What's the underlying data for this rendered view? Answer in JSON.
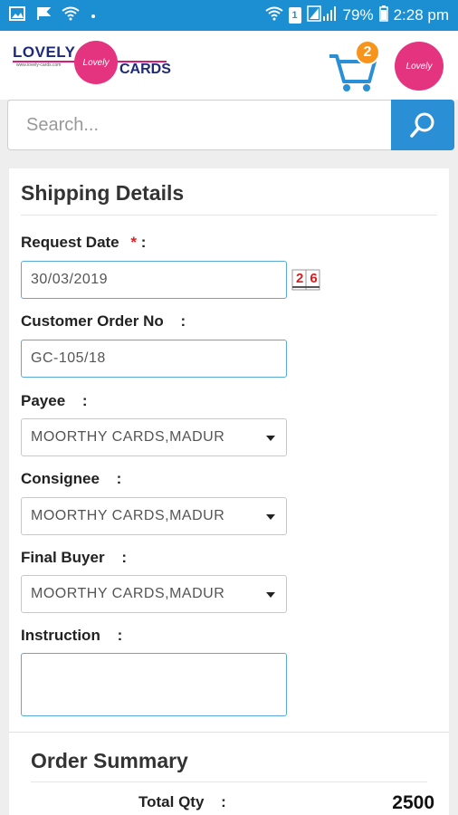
{
  "status_bar": {
    "battery": "79%",
    "time": "2:28 pm",
    "sim": "1"
  },
  "header": {
    "logo": {
      "word1": "LOVELY",
      "word2": "CARDS",
      "url": "www.lovely-cards.com",
      "emblem": "Lovely"
    },
    "cart_count": "2",
    "profile_emblem": "Lovely"
  },
  "search": {
    "placeholder": "Search..."
  },
  "shipping": {
    "title": "Shipping Details",
    "request_date": {
      "label": "Request Date",
      "required_mark": "*",
      "colon": ":",
      "value": "30/03/2019"
    },
    "calendar_icon_text": "26",
    "customer_order": {
      "label": "Customer Order No",
      "colon": ":",
      "value": "GC-105/18"
    },
    "payee": {
      "label": "Payee",
      "colon": ":",
      "value": "MOORTHY CARDS,MADUR"
    },
    "consignee": {
      "label": "Consignee",
      "colon": ":",
      "value": "MOORTHY CARDS,MADUR"
    },
    "final_buyer": {
      "label": "Final Buyer",
      "colon": ":",
      "value": "MOORTHY CARDS,MADUR"
    },
    "instruction": {
      "label": "Instruction",
      "colon": ":",
      "value": ""
    }
  },
  "order_summary": {
    "title": "Order Summary",
    "total_qty_label": "Total Qty",
    "colon": ":",
    "total_qty_value": "2500"
  },
  "colors": {
    "status_bar": "#1b8fd2",
    "search_button": "#2b8fd6",
    "cart_icon": "#2b8fd6",
    "badge": "#f7941d",
    "brand_pink": "#e5347f"
  }
}
